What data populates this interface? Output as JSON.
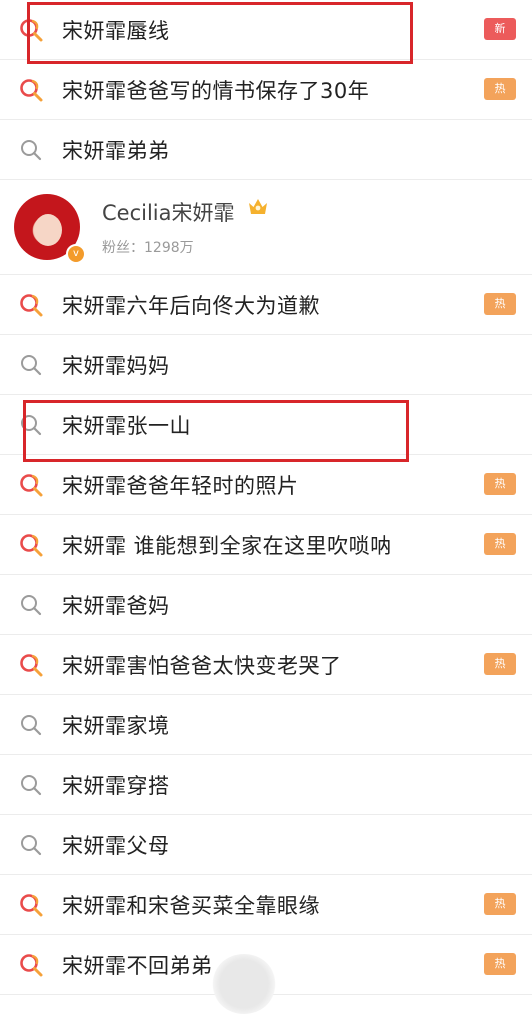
{
  "rows": [
    {
      "text": "宋妍霏蜃线",
      "icon": "hot-search-icon",
      "badge": "新",
      "badge_kind": "new"
    },
    {
      "text": "宋妍霏爸爸写的情书保存了30年",
      "icon": "hot-search-icon",
      "badge": "热",
      "badge_kind": "hot"
    },
    {
      "text": "宋妍霏弟弟",
      "icon": "search-icon",
      "badge": "",
      "badge_kind": ""
    },
    {
      "text": "宋妍霏六年后向佟大为道歉",
      "icon": "hot-search-icon",
      "badge": "热",
      "badge_kind": "hot"
    },
    {
      "text": "宋妍霏妈妈",
      "icon": "search-icon",
      "badge": "",
      "badge_kind": ""
    },
    {
      "text": "宋妍霏张一山",
      "icon": "search-icon",
      "badge": "",
      "badge_kind": ""
    },
    {
      "text": "宋妍霏爸爸年轻时的照片",
      "icon": "hot-search-icon",
      "badge": "热",
      "badge_kind": "hot"
    },
    {
      "text": "宋妍霏 谁能想到全家在这里吹唢呐",
      "icon": "hot-search-icon",
      "badge": "热",
      "badge_kind": "hot"
    },
    {
      "text": "宋妍霏爸妈",
      "icon": "search-icon",
      "badge": "",
      "badge_kind": ""
    },
    {
      "text": "宋妍霏害怕爸爸太快变老哭了",
      "icon": "hot-search-icon",
      "badge": "热",
      "badge_kind": "hot"
    },
    {
      "text": "宋妍霏家境",
      "icon": "search-icon",
      "badge": "",
      "badge_kind": ""
    },
    {
      "text": "宋妍霏穿搭",
      "icon": "search-icon",
      "badge": "",
      "badge_kind": ""
    },
    {
      "text": "宋妍霏父母",
      "icon": "search-icon",
      "badge": "",
      "badge_kind": ""
    },
    {
      "text": "宋妍霏和宋爸买菜全靠眼缘",
      "icon": "hot-search-icon",
      "badge": "热",
      "badge_kind": "hot"
    },
    {
      "text": "宋妍霏不回弟弟",
      "icon": "hot-search-icon",
      "badge": "热",
      "badge_kind": "hot"
    }
  ],
  "user": {
    "name": "Cecilia宋妍霏",
    "fans": "粉丝：1298万",
    "verified_icon": "verified-badge-icon",
    "crown_icon": "crown-icon"
  },
  "colors": {
    "hot_badge": "#f3a35b",
    "new_badge": "#ec5b5b",
    "highlight": "#d8262a",
    "hot_icon_red": "#e94b4b",
    "hot_icon_orange": "#f5a13a",
    "search_icon_gray": "#9b9b9b"
  }
}
